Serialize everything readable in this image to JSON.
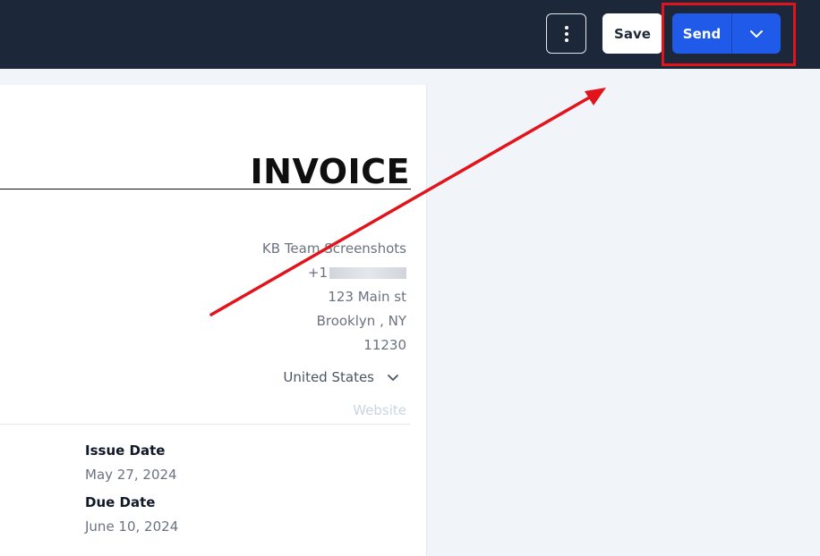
{
  "toolbar": {
    "save_label": "Save",
    "send_label": "Send"
  },
  "invoice": {
    "title": "INVOICE",
    "company_name": "KB Team Screenshots",
    "phone_prefix": "+1",
    "street": "123 Main st",
    "city_state": "Brooklyn ,  NY",
    "zip": "11230",
    "country": "United States",
    "website_placeholder": "Website",
    "issue_date_label": "Issue Date",
    "issue_date": "May 27, 2024",
    "due_date_label": "Due Date",
    "due_date": "June 10, 2024"
  },
  "icons": {
    "more": "more-vertical-icon",
    "send_dropdown": "chevron-down-icon",
    "country_dropdown": "chevron-down-icon"
  },
  "colors": {
    "topbar": "#1c273a",
    "primary": "#1f5be8",
    "annotation": "#e1141c",
    "background": "#f1f5f9"
  }
}
